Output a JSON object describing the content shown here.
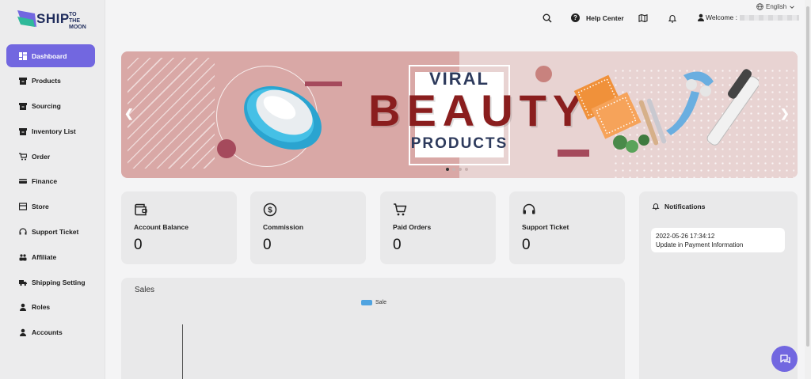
{
  "brand": {
    "name": "SHIP",
    "tagline_line1": "TO THE",
    "tagline_line2": "MOON"
  },
  "header": {
    "language": "English",
    "help_center": "Help Center",
    "welcome": "Welcome :"
  },
  "sidebar": {
    "items": [
      {
        "label": "Dashboard",
        "icon": "dashboard-icon",
        "active": true
      },
      {
        "label": "Products",
        "icon": "box-icon"
      },
      {
        "label": "Sourcing",
        "icon": "box-icon"
      },
      {
        "label": "Inventory List",
        "icon": "box-icon"
      },
      {
        "label": "Order",
        "icon": "cart-icon"
      },
      {
        "label": "Finance",
        "icon": "card-icon"
      },
      {
        "label": "Store",
        "icon": "store-icon"
      },
      {
        "label": "Support Ticket",
        "icon": "headset-icon"
      },
      {
        "label": "Affiliate",
        "icon": "people-icon"
      },
      {
        "label": "Shipping Setting",
        "icon": "truck-icon"
      },
      {
        "label": "Roles",
        "icon": "user-icon"
      },
      {
        "label": "Accounts",
        "icon": "user-icon"
      }
    ]
  },
  "banner": {
    "line1": "VIRAL",
    "line2": "BEAUTY",
    "line3": "PRODUCTS",
    "slide_count": 4,
    "active_slide": 1
  },
  "stats": [
    {
      "label": "Account Balance",
      "value": "0",
      "icon": "wallet-icon"
    },
    {
      "label": "Commission",
      "value": "0",
      "icon": "dollar-icon"
    },
    {
      "label": "Paid Orders",
      "value": "0",
      "icon": "cart-icon"
    },
    {
      "label": "Support Ticket",
      "value": "0",
      "icon": "headset-icon"
    }
  ],
  "sales": {
    "title": "Sales",
    "legend": "Sale",
    "legend_color": "#4fa3e0"
  },
  "notifications": {
    "title": "Notifications",
    "items": [
      {
        "date": "2022-05-26 17:34:12",
        "text": "Update in Payment Information"
      }
    ]
  },
  "colors": {
    "accent": "#7267e0",
    "banner_title": "#8a1e1e",
    "banner_sub": "#2d3a5c"
  }
}
